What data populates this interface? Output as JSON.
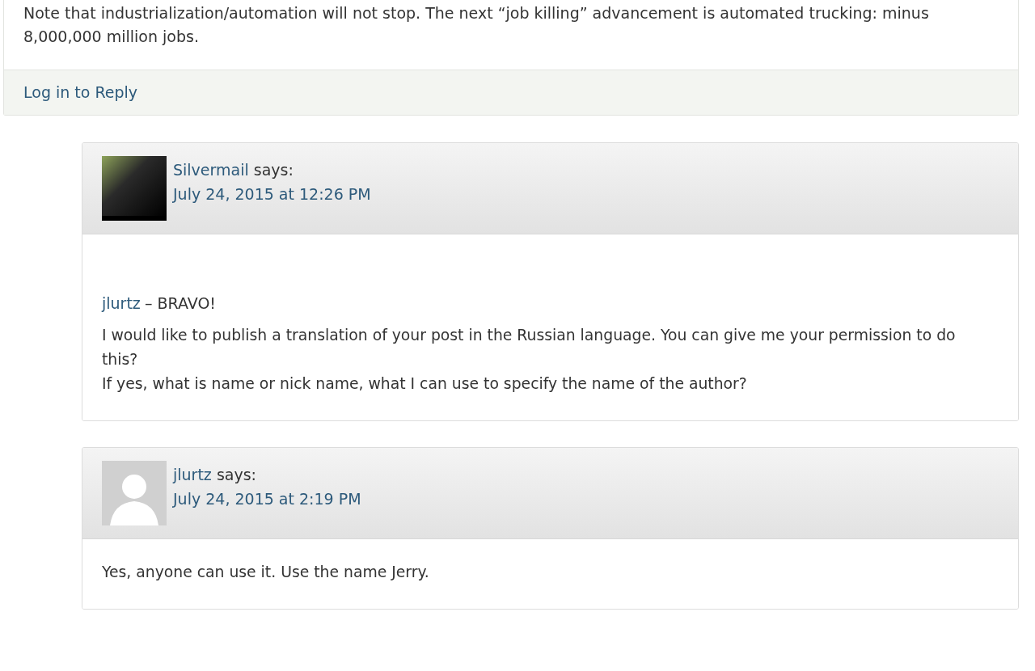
{
  "post": {
    "text": "Note that industrialization/automation will not stop.  The next “job killing” advancement is automated trucking: minus 8,000,000 million jobs.",
    "reply_link": "Log in to Reply"
  },
  "comments": [
    {
      "author": "Silvermail",
      "says": "says:",
      "date": "July 24, 2015 at 12:26 PM",
      "avatar": {
        "kind": "photo"
      },
      "spacious": true,
      "paragraphs": [
        {
          "mention": "jlurtz",
          "lines": [
            "– BRAVO!"
          ]
        },
        {
          "lines": [
            "I would like to publish a translation of your post in the Russian language. You can give me your permission to do this?",
            "If yes, what is name or nick name, what I can use to specify the name of the author?"
          ]
        }
      ]
    },
    {
      "author": "jlurtz",
      "says": "says:",
      "date": "July 24, 2015 at 2:19 PM",
      "avatar": {
        "kind": "default"
      },
      "spacious": false,
      "paragraphs": [
        {
          "lines": [
            "Yes, anyone can use it. Use the name Jerry."
          ]
        }
      ]
    }
  ]
}
